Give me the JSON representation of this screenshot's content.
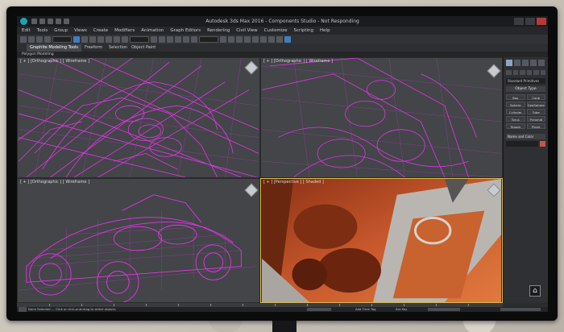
{
  "titlebar": {
    "title": "Autodesk 3ds Max 2016  -  Components Studio  -  Not Responding"
  },
  "menu": {
    "items": [
      "Edit",
      "Tools",
      "Group",
      "Views",
      "Create",
      "Modifiers",
      "Animation",
      "Graph Editors",
      "Rendering",
      "Civil View",
      "Customize",
      "Scripting",
      "Help"
    ]
  },
  "ribbon": {
    "tabs": [
      "Graphite Modeling Tools",
      "Freeform",
      "Selection",
      "Object Paint"
    ],
    "sub_label": "Polygon Modeling"
  },
  "viewports": {
    "top_left": {
      "label": "[ + ] [Orthographic ] [ Wireframe ]"
    },
    "top_right": {
      "label": "[ + ] [Orthographic ] [ Wireframe ]"
    },
    "bottom_left": {
      "label": "[ + ] [Orthographic ] [ Wireframe ]"
    },
    "bottom_right": {
      "label": "[ + ] [Perspective ] [ Shaded ]"
    }
  },
  "command_panel": {
    "dropdown": "Standard Primitives",
    "section_header": "Object Type",
    "buttons": [
      "Box",
      "Cone",
      "Sphere",
      "GeoSphere",
      "Cylinder",
      "Tube",
      "Torus",
      "Pyramid",
      "Teapot",
      "Plane"
    ],
    "name_header": "Name and Color"
  },
  "status": {
    "line1": "None Selected",
    "line2": "Click or click-and-drag to select objects",
    "add_time_tag": "Add Time Tag",
    "set_key": "Set Key"
  },
  "colors": {
    "wire": "#e535e8",
    "render_orange": "#c2502a",
    "active_border": "#d9b84a"
  }
}
